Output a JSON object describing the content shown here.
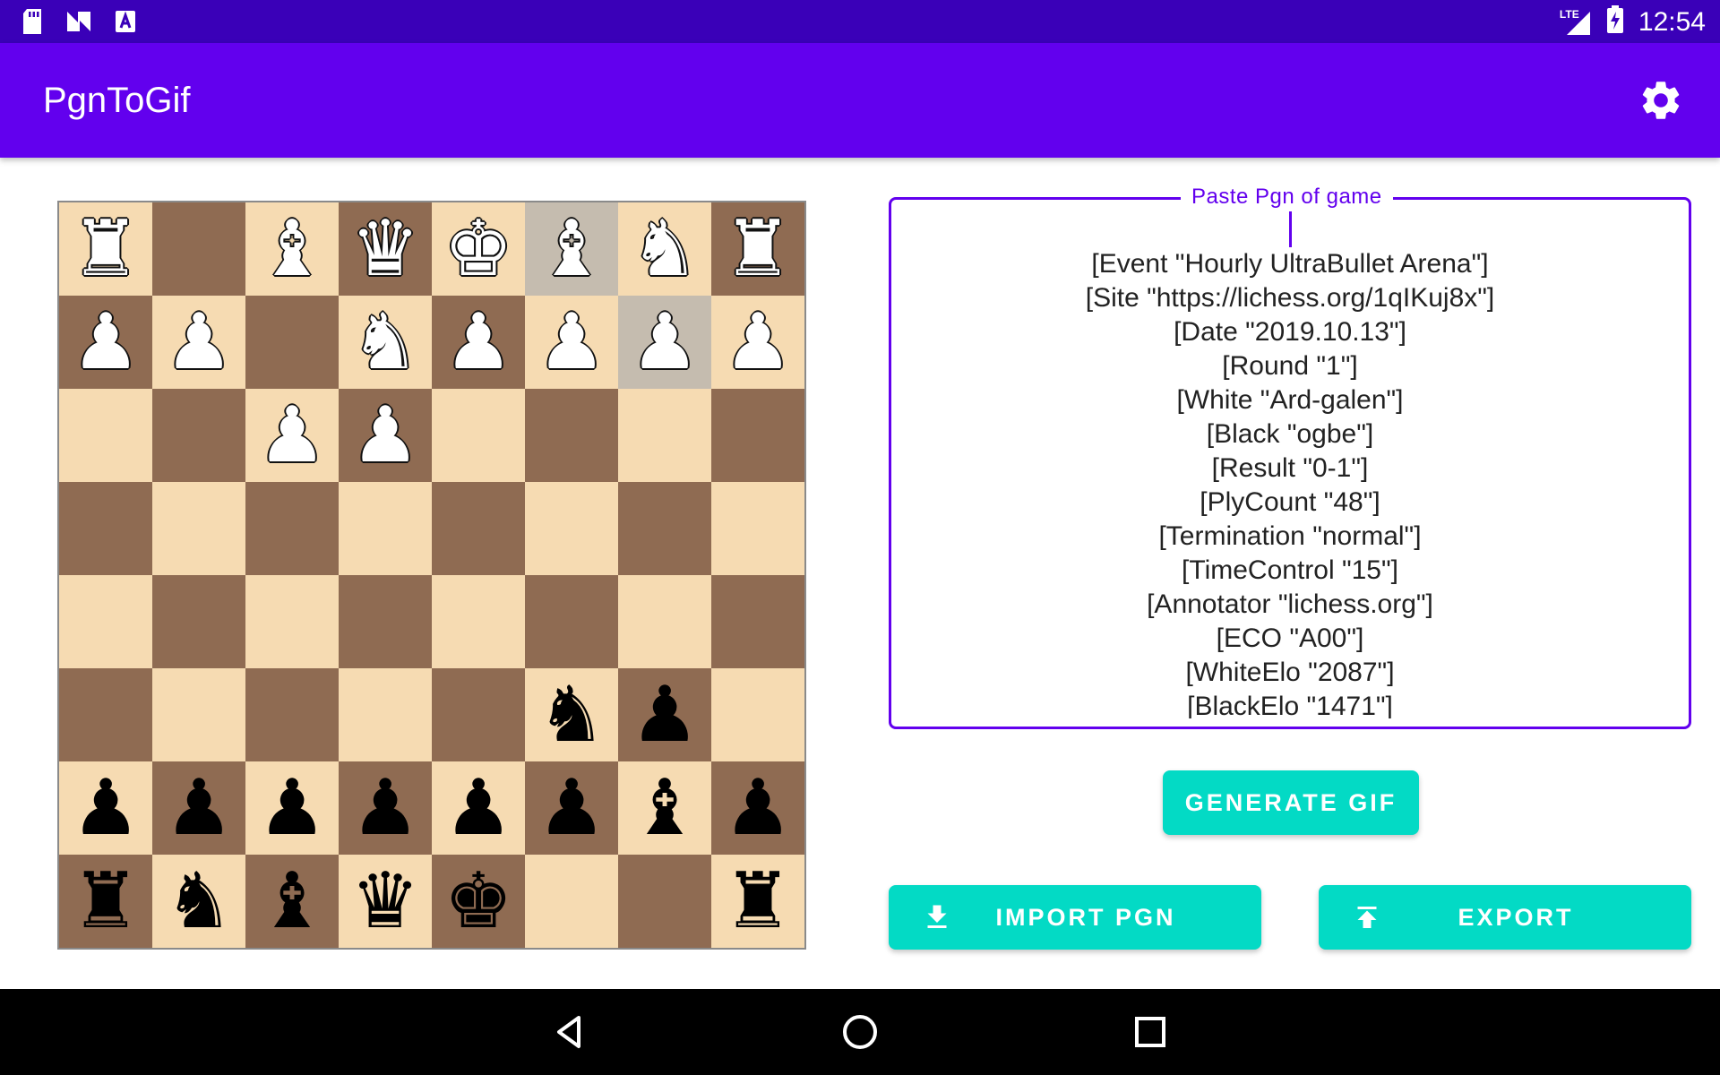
{
  "status_bar": {
    "time": "12:54",
    "network": "LTE",
    "icons": [
      "sd-card-icon",
      "n-icon",
      "a-icon",
      "signal-icon",
      "battery-charging-icon"
    ]
  },
  "app_bar": {
    "title": "PgnToGif",
    "settings_icon": "gear-icon"
  },
  "board": {
    "light_color": "#f6dbb2",
    "dark_color": "#8f6b52",
    "highlight_color": "#c5bcaf",
    "highlighted_squares": [
      "f1",
      "g2"
    ],
    "ranks": [
      [
        "wR",
        "",
        "wB",
        "wQ",
        "wK",
        "wB",
        "wN",
        "wR"
      ],
      [
        "wP",
        "wP",
        "",
        "wN",
        "wP",
        "wP",
        "wP",
        "wP"
      ],
      [
        "",
        "",
        "wP",
        "wP",
        "",
        "",
        "",
        ""
      ],
      [
        "",
        "",
        "",
        "",
        "",
        "",
        "",
        ""
      ],
      [
        "",
        "",
        "",
        "",
        "",
        "",
        "",
        ""
      ],
      [
        "",
        "",
        "",
        "",
        "",
        "bN",
        "bP",
        ""
      ],
      [
        "bP",
        "bP",
        "bP",
        "bP",
        "bP",
        "bP",
        "bB",
        "bP"
      ],
      [
        "bR",
        "bN",
        "bB",
        "bQ",
        "bK",
        "",
        "",
        "bR"
      ]
    ]
  },
  "pgn_input": {
    "label": "Paste Pgn of game",
    "lines": [
      "[Event \"Hourly UltraBullet Arena\"]",
      "[Site \"https://lichess.org/1qIKuj8x\"]",
      "[Date \"2019.10.13\"]",
      "[Round \"1\"]",
      "[White \"Ard-galen\"]",
      "[Black \"ogbe\"]",
      "[Result \"0-1\"]",
      "[PlyCount \"48\"]",
      "[Termination \"normal\"]",
      "[TimeControl \"15\"]",
      "[Annotator \"lichess.org\"]",
      "[ECO \"A00\"]",
      "[WhiteElo \"2087\"]",
      "[BlackElo \"1471\"]"
    ]
  },
  "buttons": {
    "generate": "GENERATE GIF",
    "import": "IMPORT PGN",
    "export": "EXPORT"
  },
  "colors": {
    "status_bar": "#3a00b8",
    "app_bar": "#6200ee",
    "accent": "#03dac5"
  },
  "nav_bar": {
    "icons": [
      "back-icon",
      "home-icon",
      "recents-icon"
    ]
  }
}
